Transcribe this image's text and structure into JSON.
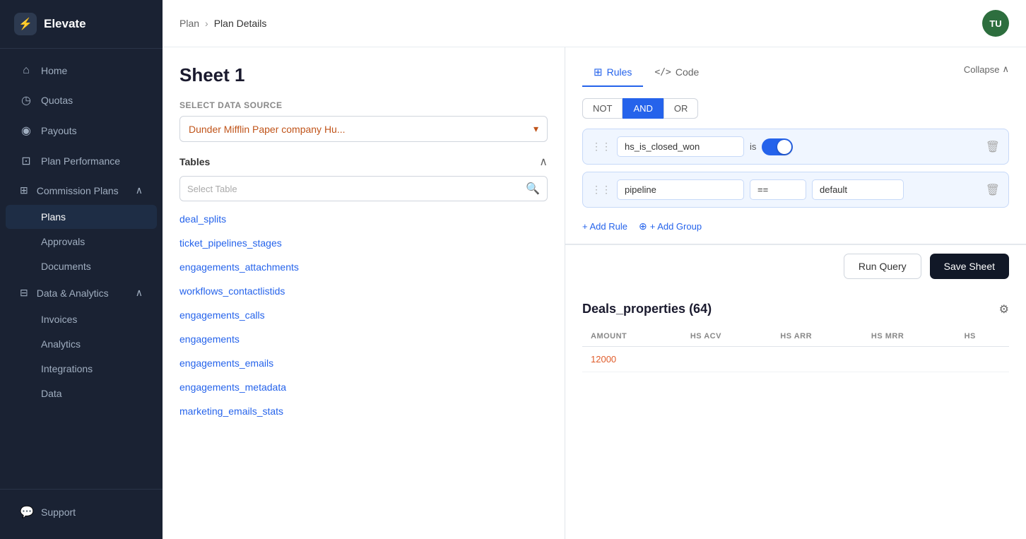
{
  "app": {
    "name": "Elevate"
  },
  "breadcrumb": {
    "parent": "Plan",
    "current": "Plan Details"
  },
  "avatar": {
    "initials": "TU"
  },
  "sidebar": {
    "nav_items": [
      {
        "id": "home",
        "label": "Home",
        "icon": "⌂"
      },
      {
        "id": "quotas",
        "label": "Quotas",
        "icon": "◷"
      },
      {
        "id": "payouts",
        "label": "Payouts",
        "icon": "◉"
      },
      {
        "id": "plan-performance",
        "label": "Plan Performance",
        "icon": "⊡"
      }
    ],
    "commission_plans": {
      "label": "Commission Plans",
      "icon": "⊞",
      "sub_items": [
        {
          "id": "plans",
          "label": "Plans",
          "active": true
        },
        {
          "id": "approvals",
          "label": "Approvals"
        },
        {
          "id": "documents",
          "label": "Documents"
        }
      ]
    },
    "data_analytics": {
      "label": "Data & Analytics",
      "icon": "⊟",
      "sub_items": [
        {
          "id": "invoices",
          "label": "Invoices"
        },
        {
          "id": "analytics",
          "label": "Analytics"
        },
        {
          "id": "integrations",
          "label": "Integrations"
        },
        {
          "id": "data",
          "label": "Data"
        }
      ]
    },
    "support": {
      "label": "Support",
      "icon": "💬"
    }
  },
  "sheet": {
    "title": "Sheet 1"
  },
  "datasource": {
    "label": "Select Data Source",
    "value": "Dunder Mifflin Paper company Hu..."
  },
  "tables": {
    "label": "Tables",
    "search_placeholder": "Select Table",
    "items": [
      "deal_splits",
      "ticket_pipelines_stages",
      "engagements_attachments",
      "workflows_contactlistids",
      "engagements_calls",
      "engagements",
      "engagements_emails",
      "engagements_metadata",
      "marketing_emails_stats"
    ]
  },
  "rules": {
    "tabs": [
      {
        "id": "rules",
        "label": "Rules",
        "active": true,
        "icon": "⊞"
      },
      {
        "id": "code",
        "label": "Code",
        "active": false,
        "icon": "</>"
      }
    ],
    "collapse_label": "Collapse",
    "conditions": [
      {
        "id": "NOT",
        "label": "NOT"
      },
      {
        "id": "AND",
        "label": "AND",
        "active": true
      },
      {
        "id": "OR",
        "label": "OR"
      }
    ],
    "rule_rows": [
      {
        "field": "hs_is_closed_won",
        "operator": "is",
        "value_type": "toggle",
        "value": true
      },
      {
        "field": "pipeline",
        "operator": "==",
        "value_type": "text",
        "value": "default"
      }
    ],
    "add_rule_label": "+ Add Rule",
    "add_group_label": "+ Add Group"
  },
  "buttons": {
    "run_query": "Run Query",
    "save_sheet": "Save Sheet"
  },
  "results": {
    "title": "Deals_properties (64)",
    "columns": [
      "AMOUNT",
      "HS ACV",
      "HS ARR",
      "HS MRR",
      "HS"
    ],
    "rows": [
      [
        "12000",
        "",
        "",
        "",
        ""
      ]
    ]
  }
}
